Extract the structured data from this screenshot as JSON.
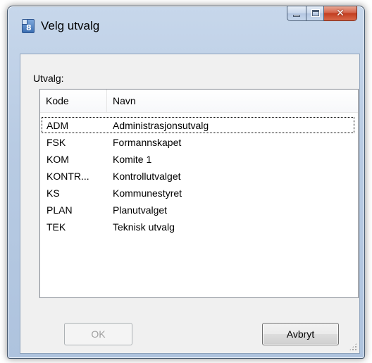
{
  "window": {
    "title": "Velg utvalg",
    "app_icon": "app-document-icon",
    "controls": [
      "minimize-icon",
      "maximize-icon",
      "close-icon"
    ]
  },
  "group": {
    "label": "Utvalg:"
  },
  "list": {
    "columns": [
      "Kode",
      "Navn"
    ],
    "rows": [
      {
        "kode": "ADM",
        "navn": "Administrasjonsutvalg",
        "focused": true
      },
      {
        "kode": "FSK",
        "navn": "Formannskapet"
      },
      {
        "kode": "KOM",
        "navn": "Komite 1"
      },
      {
        "kode": "KONTR...",
        "navn": "Kontrollutvalget"
      },
      {
        "kode": "KS",
        "navn": "Kommunestyret"
      },
      {
        "kode": "PLAN",
        "navn": "Planutvalget"
      },
      {
        "kode": "TEK",
        "navn": "Teknisk utvalg"
      }
    ]
  },
  "buttons": {
    "ok_label": "OK",
    "ok_disabled": true,
    "cancel_label": "Avbryt"
  },
  "colors": {
    "frame": "#b8cbe3",
    "close_button": "#c23d20",
    "client": "#f0f0f0",
    "disabled_text": "#a0a0a0"
  }
}
